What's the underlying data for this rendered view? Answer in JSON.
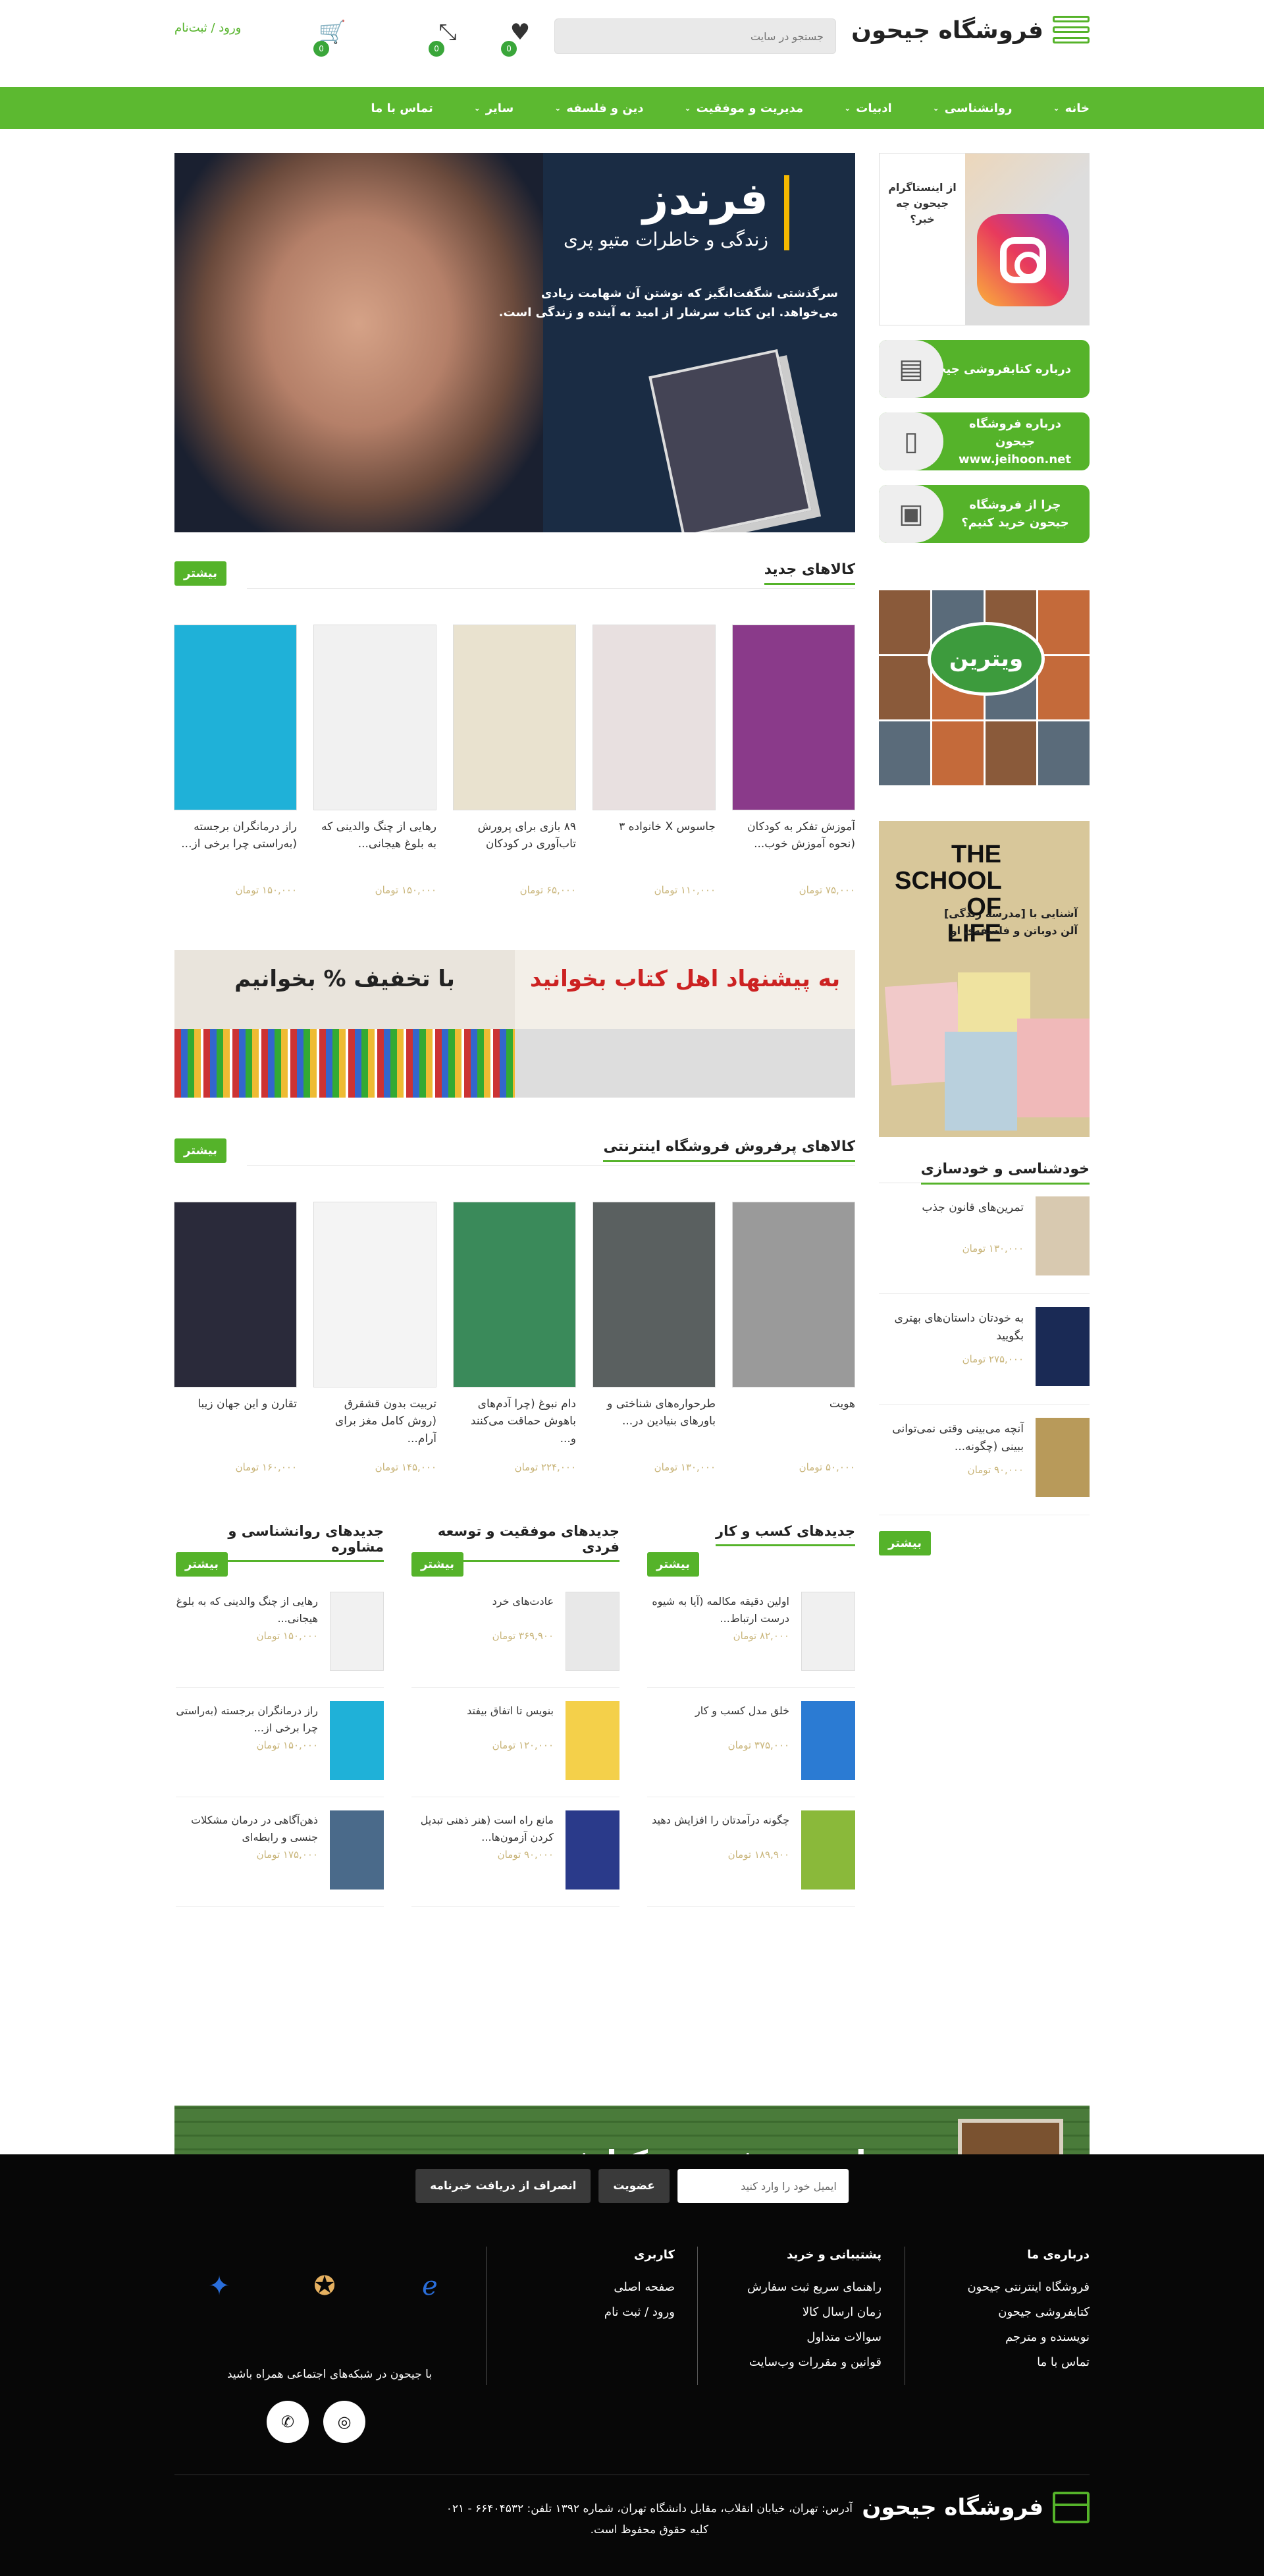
{
  "header": {
    "logo_text": "فروشگاه جیحون",
    "search_placeholder": "جستجو در سایت",
    "wishlist_count": "0",
    "compare_count": "0",
    "cart_count": "0",
    "login_label": "ورود / ثبت‌نام"
  },
  "nav": [
    {
      "label": "خانه"
    },
    {
      "label": "روانشناسی"
    },
    {
      "label": "ادبیات"
    },
    {
      "label": "مدیریت و موفقیت"
    },
    {
      "label": "دین و فلسفه"
    },
    {
      "label": "سایر"
    },
    {
      "label": "تماس با ما"
    }
  ],
  "sidebar": {
    "instagram_text": "از اینستاگرام جیحون چه خبر؟",
    "buttons": [
      {
        "label": "درباره کتابفروشی جیحون",
        "icon": "building-icon"
      },
      {
        "label": "درباره فروشگاه جیحون www.jeihoon.net",
        "icon": "phone-icon"
      },
      {
        "label": "چرا از فروشگاه جیحون خرید کنیم؟",
        "icon": "shop-icon"
      }
    ],
    "vitrin_label": "ویترین",
    "school": {
      "title": "THE SCHOOL OF LIFE",
      "subtitle": "آشنایی با [مدرسه زندگی] آلن دوباتن و فلسفه‌ی او"
    },
    "selfhelp": {
      "title": "خودشناسی و خودسازی",
      "more": "بیشتر",
      "items": [
        {
          "title": "تمرین‌های قانون جذب",
          "price": "۱۳۰,۰۰۰ تومان",
          "color": "#d8c9b0"
        },
        {
          "title": "به خودتان داستان‌های بهتری بگویید",
          "price": "۲۷۵,۰۰۰ تومان",
          "color": "#1a2a55"
        },
        {
          "title": "آنچه می‌بینی وقتی نمی‌توانی ببینی (چگونه...",
          "price": "۹۰,۰۰۰ تومان",
          "color": "#b89a5a"
        }
      ]
    }
  },
  "hero": {
    "title": "فرندز",
    "subtitle": "زندگی و خاطرات متیو پری",
    "desc": "سرگذشتی شگفت‌انگیز که نوشتن آن شهامت زیادی می‌خواهد. این کتاب سرشار از امید به آینده و زندگی است."
  },
  "new_products": {
    "title": "کالاهای جدید",
    "more": "بیشتر",
    "items": [
      {
        "title": "آموزش تفکر به کودکان (نحوه آموزش خوب...",
        "price": "۷۵,۰۰۰ تومان",
        "color": "#8a3a8a"
      },
      {
        "title": "جاسوس X خانواده ۳",
        "price": "۱۱۰,۰۰۰ تومان",
        "color": "#e8e0e0"
      },
      {
        "title": "۸۹ بازی برای پرورش تاب‌آوری در کودکان",
        "price": "۶۵,۰۰۰ تومان",
        "color": "#e9e2cf"
      },
      {
        "title": "رهایی از چنگ والدینی که به بلوغ هیجانی...",
        "price": "۱۵۰,۰۰۰ تومان",
        "color": "#f1f1f1"
      },
      {
        "title": "راز درمانگران برجسته (به‌راستی چرا برخی از...",
        "price": "۱۵۰,۰۰۰ تومان",
        "color": "#1fb1d8"
      }
    ]
  },
  "banners": [
    {
      "caption": "به پیشنهاد اهل کتاب بخوانید"
    },
    {
      "caption": "با تخفیف % بخوانیم"
    }
  ],
  "bestsellers": {
    "title": "کالاهای پرفروش فروشگاه اینترنتی",
    "more": "بیشتر",
    "items": [
      {
        "title": "هویت",
        "price": "۵۰,۰۰۰ تومان",
        "color": "#9a9a9a"
      },
      {
        "title": "طرحواره‌های شناختی و باورهای بنیادین در...",
        "price": "۱۳۰,۰۰۰ تومان",
        "color": "#5a6060"
      },
      {
        "title": "دام نبوغ (چرا آدم‌های باهوش حماقت می‌کنند و...",
        "price": "۲۲۴,۰۰۰ تومان",
        "color": "#3a8a5a"
      },
      {
        "title": "تربیت بدون قشقرق (روش کامل مغز برای آرام...",
        "price": "۱۴۵,۰۰۰ تومان",
        "color": "#f4f4f4"
      },
      {
        "title": "تقارن و این جهان زیبا",
        "price": "۱۶۰,۰۰۰ تومان",
        "color": "#2a2a3a"
      }
    ]
  },
  "columns": [
    {
      "title": "جدیدهای کسب و کار",
      "more": "بیشتر",
      "items": [
        {
          "title": "اولین دقیقه مکالمه (آیا به شیوه درست ارتباط...",
          "price": "۸۲,۰۰۰ تومان",
          "color": "#f0f0f0"
        },
        {
          "title": "خلق مدل کسب و کار",
          "price": "۳۷۵,۰۰۰ تومان",
          "color": "#2b7bd3"
        },
        {
          "title": "چگونه درآمدتان را افزایش دهید",
          "price": "۱۸۹,۹۰۰ تومان",
          "color": "#8ab93a"
        }
      ]
    },
    {
      "title": "جدیدهای موفقیت و توسعه فردی",
      "more": "بیشتر",
      "items": [
        {
          "title": "عادت‌های خرد",
          "price": "۳۶۹,۹۰۰ تومان",
          "color": "#e8e8e8"
        },
        {
          "title": "بنویس تا اتفاق بیفتد",
          "price": "۱۲۰,۰۰۰ تومان",
          "color": "#f4d04a"
        },
        {
          "title": "مانع راه است (هنر ذهنی تبدیل کردن آزمون‌ها...",
          "price": "۹۰,۰۰۰ تومان",
          "color": "#2a3a8a"
        }
      ]
    },
    {
      "title": "جدیدهای روانشناسی و مشاوره",
      "more": "بیشتر",
      "items": [
        {
          "title": "رهایی از چنگ والدینی که به بلوغ هیجانی...",
          "price": "۱۵۰,۰۰۰ تومان",
          "color": "#f1f1f1"
        },
        {
          "title": "راز درمانگران برجسته (به‌راستی چرا برخی از...",
          "price": "۱۵۰,۰۰۰ تومان",
          "color": "#1fb1d8"
        },
        {
          "title": "ذهن‌آگاهی در درمان مشکلات جنسی و رابطه‌ای",
          "price": "۱۷۵,۰۰۰ تومان",
          "color": "#4a6a8a"
        }
      ]
    }
  ],
  "best_banner": "عناوین پرفروش کتابفروشی جیحون",
  "footer": {
    "newsletter_placeholder": "ایمیل خود را وارد کنید",
    "subscribe": "عضویت",
    "unsubscribe": "انصراف از دریافت خبرنامه",
    "col_about": {
      "title": "درباره‌ی ما",
      "links": [
        "فروشگاه اینترنتی جیحون",
        "کتابفروشی جیحون",
        "نویسنده و مترجم",
        "تماس با ما"
      ]
    },
    "col_support": {
      "title": "پشتیبانی و خرید",
      "links": [
        "راهنمای سریع ثبت سفارش",
        "زمان ارسال کالا",
        "سوالات متداول",
        "قوانین و مقررات وب‌سایت"
      ]
    },
    "col_user": {
      "title": "کاربری",
      "links": [
        "صفحه اصلی",
        "ورود / ثبت نام"
      ]
    },
    "social_caption": "با جیحون در شبکه‌های اجتماعی همراه باشید",
    "logo_text": "فروشگاه جیحون",
    "address": "آدرس: تهران، خیابان انقلاب، مقابل دانشگاه تهران، شماره ۱۳۹۲ تلفن: ۶۶۴۰۴۵۳۲ - ۰۲۱",
    "copyright": "کلیه حقوق محفوظ است."
  }
}
